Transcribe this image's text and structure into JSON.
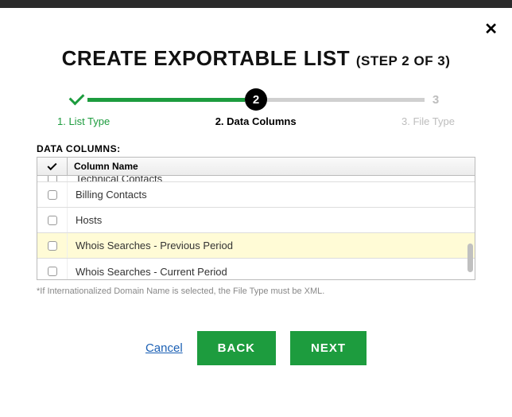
{
  "header": {
    "title": "CREATE EXPORTABLE LIST",
    "step_suffix": "(STEP 2 OF 3)"
  },
  "stepper": {
    "steps": [
      {
        "num": "1",
        "label": "1. List Type",
        "state": "done"
      },
      {
        "num": "2",
        "label": "2. Data Columns",
        "state": "current"
      },
      {
        "num": "3",
        "label": "3. File Type",
        "state": "future"
      }
    ]
  },
  "section": {
    "label": "DATA COLUMNS:"
  },
  "table": {
    "header": {
      "column_name": "Column Name"
    },
    "rows": [
      {
        "label": "Technical Contacts",
        "checked": false,
        "highlight": false,
        "cut": true
      },
      {
        "label": "Billing Contacts",
        "checked": false,
        "highlight": false
      },
      {
        "label": "Hosts",
        "checked": false,
        "highlight": false
      },
      {
        "label": "Whois Searches - Previous Period",
        "checked": false,
        "highlight": true
      },
      {
        "label": "Whois Searches - Current Period",
        "checked": false,
        "highlight": false
      }
    ]
  },
  "footnote": "*If Internationalized Domain Name is selected, the File Type must be XML.",
  "actions": {
    "cancel": "Cancel",
    "back": "BACK",
    "next": "NEXT"
  }
}
